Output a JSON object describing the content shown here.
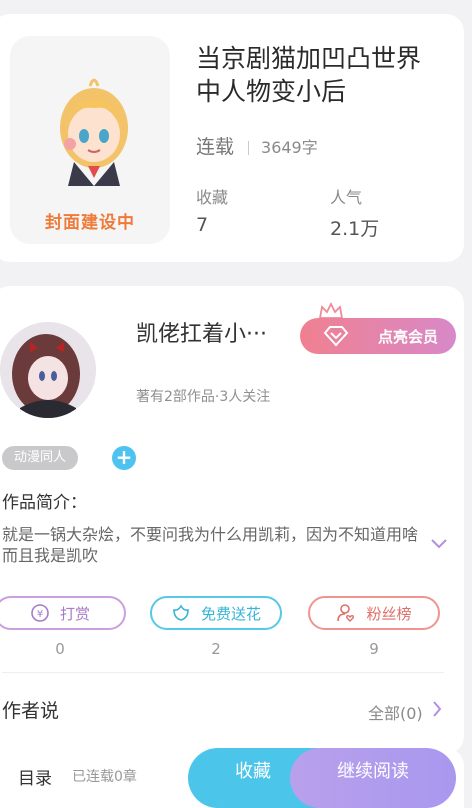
{
  "book": {
    "title": "当京剧猫加凹凸世界中人物变小后",
    "cover_caption": "封面建设中",
    "status": "连载",
    "word_count": "3649字",
    "favorites_label": "收藏",
    "favorites_value": "7",
    "popularity_label": "人气",
    "popularity_value": "2.1万"
  },
  "author": {
    "name": "凯佬扛着小···",
    "vip_button": "点亮会员",
    "meta": "著有2部作品·3人关注",
    "tag": "动漫同人",
    "add_tag_symbol": "+",
    "intro_label": "作品简介：",
    "intro_text": "就是一锅大杂烩，不要问我为什么用凯莉，因为不知道用啥而且我是凯吹"
  },
  "actions": [
    {
      "label": "打赏",
      "count": "0",
      "icon": "coin-icon",
      "color": "#a77bc6"
    },
    {
      "label": "免费送花",
      "count": "2",
      "icon": "flower-icon",
      "color": "#38b5d6"
    },
    {
      "label": "粉丝榜",
      "count": "9",
      "icon": "fan-rank-icon",
      "color": "#e06e6a"
    }
  ],
  "author_says": {
    "label": "作者说",
    "all_link": "全部(0)"
  },
  "bottom_bar": {
    "toc_label": "目录",
    "toc_meta": "已连载0章",
    "favorite_button": "收藏",
    "read_button": "继续阅读"
  },
  "colors": {
    "accent_blue": "#4cc5ea",
    "accent_purple": "#b9a0ec",
    "cover_caption": "#ef7b3b"
  }
}
